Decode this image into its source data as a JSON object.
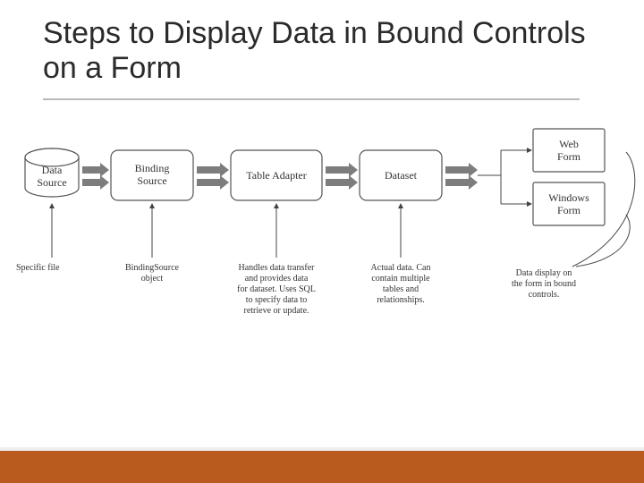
{
  "title": "Steps to Display Data in Bound Controls on a Form",
  "nodes": {
    "dataSource": {
      "label1": "Data",
      "label2": "Source"
    },
    "bindingSource": {
      "label1": "Binding",
      "label2": "Source"
    },
    "tableAdapter": {
      "label": "Table Adapter"
    },
    "dataset": {
      "label": "Dataset"
    },
    "webForm": {
      "label1": "Web",
      "label2": "Form"
    },
    "windowsForm": {
      "label1": "Windows",
      "label2": "Form"
    }
  },
  "captions": {
    "specificFile": "Specific file",
    "bindingSrc": [
      "BindingSource",
      "object"
    ],
    "tableAdapter": [
      "Handles data transfer",
      "and provides data",
      "for dataset. Uses SQL",
      "to specify data to",
      "retrieve or update."
    ],
    "dataset": [
      "Actual data. Can",
      "contain multiple",
      "tables and",
      "relationships."
    ],
    "forms": [
      "Data display on",
      "the form in bound",
      "controls."
    ]
  }
}
